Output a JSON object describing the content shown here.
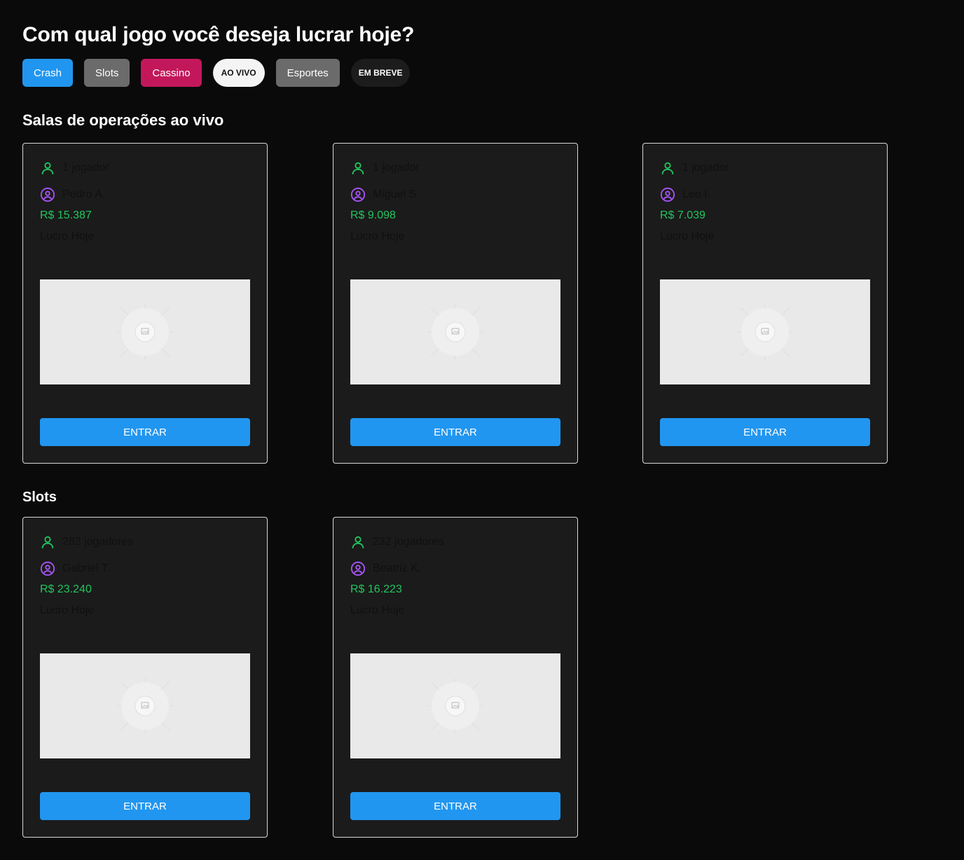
{
  "page": {
    "title": "Com qual jogo você deseja lucrar hoje?"
  },
  "filters": [
    {
      "label": "Crash",
      "color": "#2196f0"
    },
    {
      "label": "Slots",
      "color": "#6b6b6b"
    },
    {
      "label": "Cassino",
      "color": "#c2185b"
    },
    {
      "label": "AO VIVO",
      "color": "#f4f4f4"
    },
    {
      "label": "Esportes",
      "color": "#6b6b6b"
    },
    {
      "label": "EM BREVE",
      "color": "#1c1c1c"
    }
  ],
  "sections": {
    "live": {
      "title": "Salas de operações ao vivo",
      "cards": [
        {
          "players": "1 jogador",
          "user": "Pedro A.",
          "profit": "R$ 15.387",
          "profit_label": "Lucro Hoje",
          "button": "ENTRAR"
        },
        {
          "players": "1 jogador",
          "user": "Miguel S.",
          "profit": "R$ 9.098",
          "profit_label": "Lucro Hoje",
          "button": "ENTRAR"
        },
        {
          "players": "1 jogador",
          "user": "Leo I.",
          "profit": "R$ 7.039",
          "profit_label": "Lucro Hoje",
          "button": "ENTRAR"
        }
      ]
    },
    "slots": {
      "title": "Slots",
      "cards": [
        {
          "players": "282 jogadores",
          "user": "Gabriel T.",
          "profit": "R$ 23.240",
          "profit_label": "Lucro Hoje",
          "button": "ENTRAR"
        },
        {
          "players": "232 jogadores",
          "user": "Beatriz K.",
          "profit": "R$ 16.223",
          "profit_label": "Lucro Hoje",
          "button": "ENTRAR"
        }
      ]
    }
  },
  "icons": {
    "players": "user-icon",
    "user": "user-circle-icon",
    "thumbnail": "image-placeholder-icon"
  },
  "colors": {
    "accent": "#2196f0",
    "profit": "#22c55e",
    "players_icon": "#22c55e",
    "user_icon": "#a855f7"
  }
}
